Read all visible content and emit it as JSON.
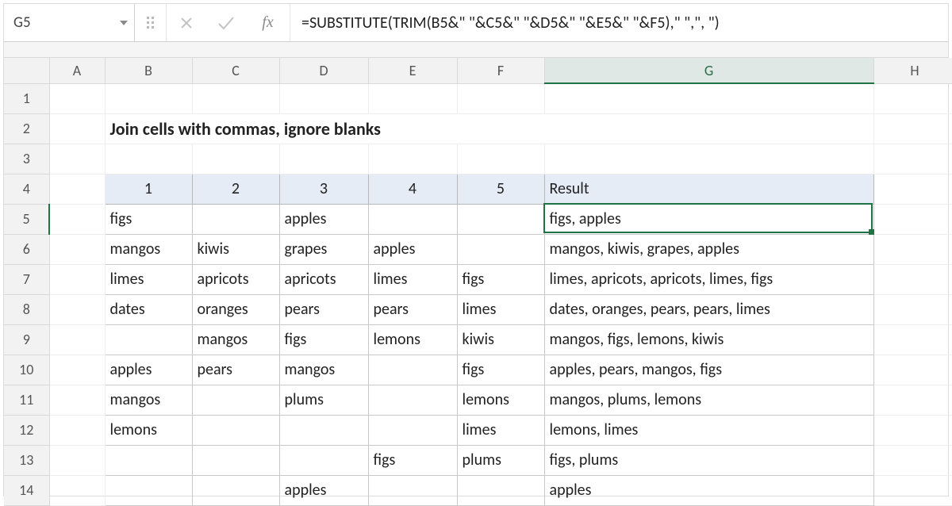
{
  "colors": {
    "accent": "#217346",
    "header_fill": "#e5ecf6"
  },
  "name_box": {
    "value": "G5"
  },
  "formula_bar": {
    "fx_label": "fx",
    "formula": "=SUBSTITUTE(TRIM(B5&\" \"&C5&\" \"&D5&\" \"&E5&\" \"&F5),\" \",\", \")"
  },
  "column_headers": [
    "A",
    "B",
    "C",
    "D",
    "E",
    "F",
    "G",
    "H"
  ],
  "row_headers": [
    "1",
    "2",
    "3",
    "4",
    "5",
    "6",
    "7",
    "8",
    "9",
    "10",
    "11",
    "12",
    "13",
    "14"
  ],
  "title": "Join cells with commas, ignore blanks",
  "data_header": {
    "col1": "1",
    "col2": "2",
    "col3": "3",
    "col4": "4",
    "col5": "5",
    "result": "Result"
  },
  "rows": [
    {
      "c": [
        "figs",
        "",
        "apples",
        "",
        ""
      ],
      "result": "figs, apples"
    },
    {
      "c": [
        "mangos",
        "kiwis",
        "grapes",
        "apples",
        ""
      ],
      "result": "mangos, kiwis, grapes, apples"
    },
    {
      "c": [
        "limes",
        "apricots",
        "apricots",
        "limes",
        "figs"
      ],
      "result": "limes, apricots, apricots, limes, figs"
    },
    {
      "c": [
        "dates",
        "oranges",
        "pears",
        "pears",
        "limes"
      ],
      "result": "dates, oranges, pears, pears, limes"
    },
    {
      "c": [
        "",
        "mangos",
        "figs",
        "lemons",
        "kiwis"
      ],
      "result": "mangos, figs, lemons, kiwis"
    },
    {
      "c": [
        "apples",
        "pears",
        "mangos",
        "",
        "figs"
      ],
      "result": "apples, pears, mangos, figs"
    },
    {
      "c": [
        "mangos",
        "",
        "plums",
        "",
        "lemons"
      ],
      "result": "mangos, plums, lemons"
    },
    {
      "c": [
        "lemons",
        "",
        "",
        "",
        "limes"
      ],
      "result": "lemons, limes"
    },
    {
      "c": [
        "",
        "",
        "",
        "figs",
        "plums"
      ],
      "result": "figs, plums"
    },
    {
      "c": [
        "",
        "",
        "apples",
        "",
        ""
      ],
      "result": "apples"
    }
  ],
  "active_cell": "G5"
}
